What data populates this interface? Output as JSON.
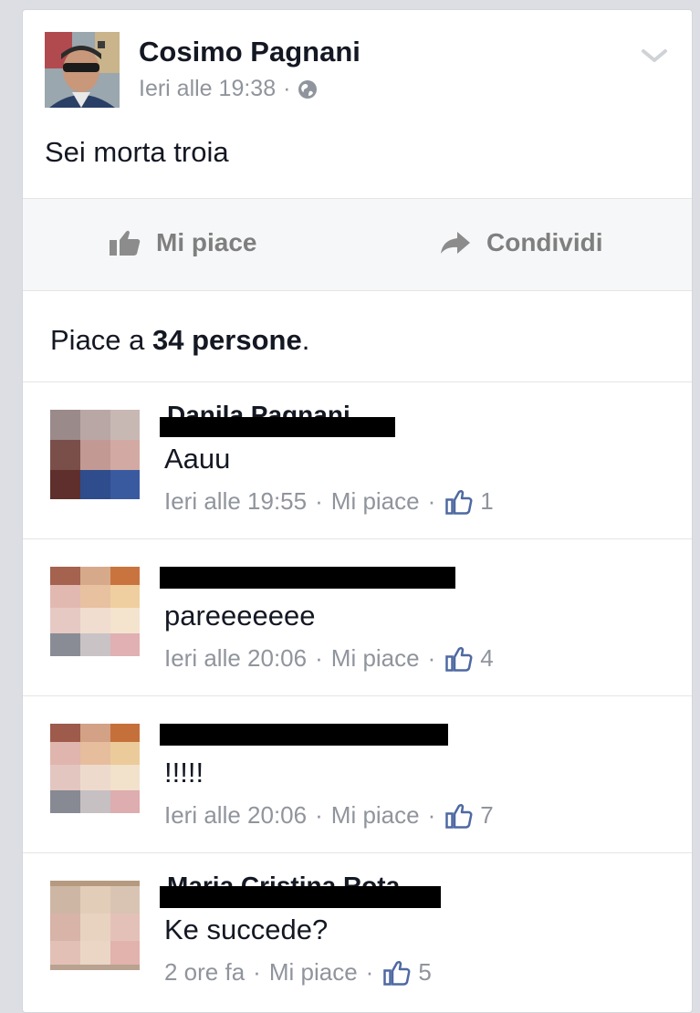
{
  "post": {
    "author": "Cosimo Pagnani",
    "timestamp": "Ieri alle 19:38",
    "separator": "·",
    "privacy_icon": "globe-icon",
    "text": "Sei morta troia"
  },
  "actions": {
    "like_label": "Mi piace",
    "share_label": "Condividi"
  },
  "likes_summary": {
    "prefix": "Piace a ",
    "count": "34 persone",
    "suffix": "."
  },
  "comments": [
    {
      "author": "Danila Pagnani",
      "text": "Aauu",
      "time": "Ieri alle 19:55",
      "like_label": "Mi piace",
      "likes": "1"
    },
    {
      "author": "",
      "text": "pareeeeeee",
      "time": "Ieri alle 20:06",
      "like_label": "Mi piace",
      "likes": "4"
    },
    {
      "author": "",
      "text": "!!!!!",
      "time": "Ieri alle 20:06",
      "like_label": "Mi piace",
      "likes": "7"
    },
    {
      "author": "Maria Cristina Rota",
      "text": "Ke succede?",
      "time": "2 ore fa",
      "like_label": "Mi piace",
      "likes": "5"
    }
  ],
  "colors": {
    "accent": "#4e69a2",
    "meta_gray": "#90949c",
    "action_gray": "#7f7f7f",
    "redaction": "#000000"
  }
}
